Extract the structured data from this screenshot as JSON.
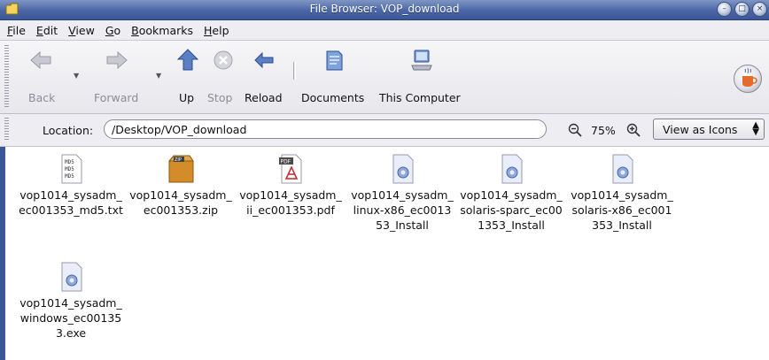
{
  "window": {
    "title": "File Browser: VOP_download"
  },
  "menubar": {
    "items": [
      {
        "mnemonic": "F",
        "rest": "ile"
      },
      {
        "mnemonic": "E",
        "rest": "dit"
      },
      {
        "mnemonic": "V",
        "rest": "iew"
      },
      {
        "mnemonic": "G",
        "rest": "o"
      },
      {
        "mnemonic": "B",
        "rest": "ookmarks"
      },
      {
        "mnemonic": "H",
        "rest": "elp"
      }
    ]
  },
  "toolbar": {
    "back_label": "Back",
    "forward_label": "Forward",
    "up_label": "Up",
    "stop_label": "Stop",
    "reload_label": "Reload",
    "documents_label": "Documents",
    "computer_label": "This Computer"
  },
  "location": {
    "label": "Location:",
    "value": "/Desktop/VOP_download",
    "zoom_level": "75%",
    "view_mode": "View as Icons"
  },
  "files": [
    {
      "name": "vop1014_sysadm_ec001353_md5.txt",
      "icon": "text-file-icon"
    },
    {
      "name": "vop1014_sysadm_ec001353.zip",
      "icon": "zip-archive-icon"
    },
    {
      "name": "vop1014_sysadm_ii_ec001353.pdf",
      "icon": "pdf-file-icon"
    },
    {
      "name": "vop1014_sysadm_linux-x86_ec001353_Install",
      "icon": "executable-file-icon"
    },
    {
      "name": "vop1014_sysadm_solaris-sparc_ec001353_Install",
      "icon": "executable-file-icon"
    },
    {
      "name": "vop1014_sysadm_solaris-x86_ec001353_Install",
      "icon": "executable-file-icon"
    },
    {
      "name": "vop1014_sysadm_windows_ec001353.exe",
      "icon": "executable-file-icon"
    }
  ],
  "colors": {
    "titlebar": "#4a66a6",
    "accent": "#3b5797"
  }
}
